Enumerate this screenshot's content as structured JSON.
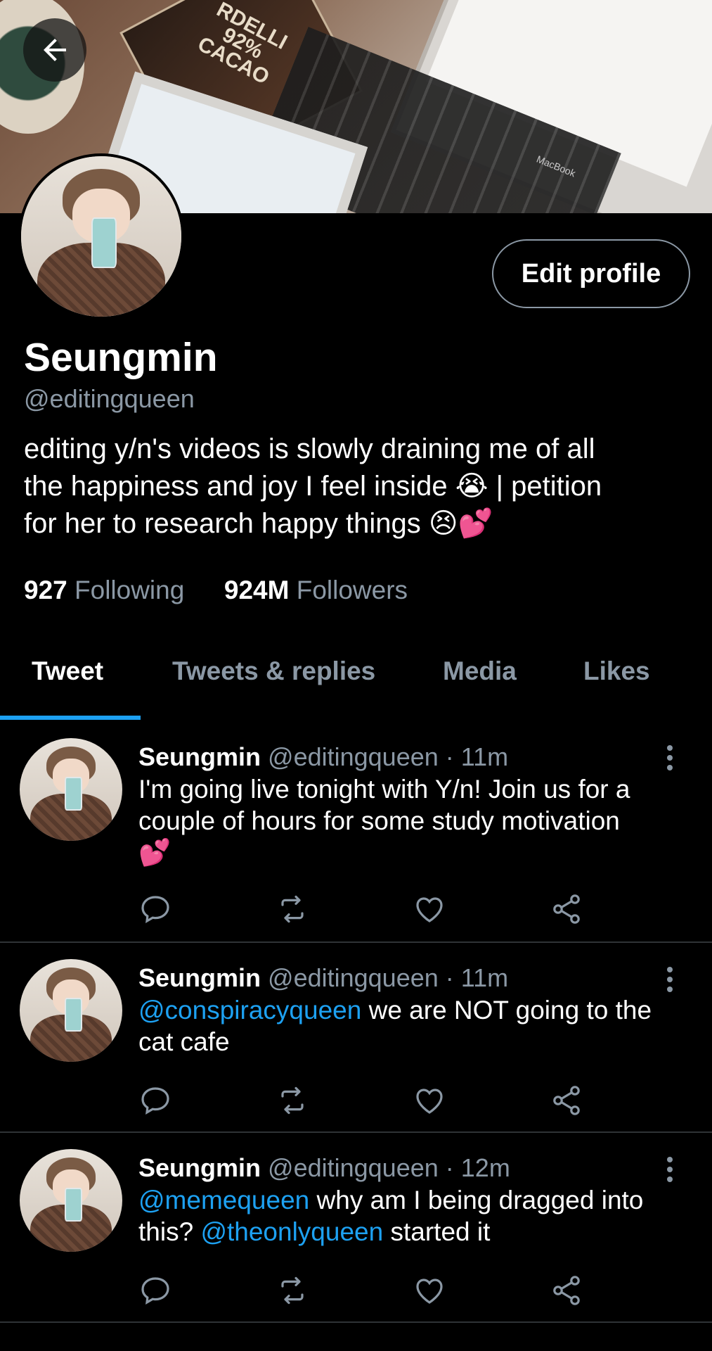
{
  "header": {
    "back_label": "Back"
  },
  "banner": {
    "chocolate_brand": "RDELLI",
    "chocolate_percent": "92%",
    "chocolate_word": "CACAO",
    "laptop_brand": "MacBook"
  },
  "profile": {
    "edit_label": "Edit profile",
    "name": "Seungmin",
    "handle": "@editingqueen",
    "bio_line1": "editing y/n's videos is slowly draining me of all",
    "bio_line2": "the happiness and joy I feel inside 😭 | petition",
    "bio_line3": "for her to research happy things 😣💕",
    "following_count": "927",
    "following_label": "Following",
    "followers_count": "924M",
    "followers_label": "Followers"
  },
  "tabs": [
    {
      "label": "Tweet",
      "active": true
    },
    {
      "label": "Tweets & replies",
      "active": false
    },
    {
      "label": "Media",
      "active": false
    },
    {
      "label": "Likes",
      "active": false
    }
  ],
  "tweets": [
    {
      "name": "Seungmin",
      "handle": "@editingqueen",
      "time": "· 11m",
      "line1": "I'm going live tonight with Y/n! Join us for a",
      "line2": "couple of hours for some study motivation",
      "line3": "💕"
    },
    {
      "name": "Seungmin",
      "handle": "@editingqueen",
      "time": "· 11m",
      "mention1": "@conspiracyqueen",
      "text1": " we are NOT going to the",
      "text2": "cat cafe"
    },
    {
      "name": "Seungmin",
      "handle": "@editingqueen",
      "time": "· 12m",
      "mention1": "@memequeen",
      "text1": " why am I being dragged into",
      "text2a": "this? ",
      "mention2": "@theonlyqueen",
      "text2b": " started it"
    }
  ],
  "icons": [
    "back-arrow-icon",
    "reply-icon",
    "retweet-icon",
    "like-icon",
    "share-icon",
    "more-icon"
  ],
  "colors": {
    "accent": "#1da1f2",
    "muted": "#8b98a5",
    "divider": "#2f3336"
  }
}
